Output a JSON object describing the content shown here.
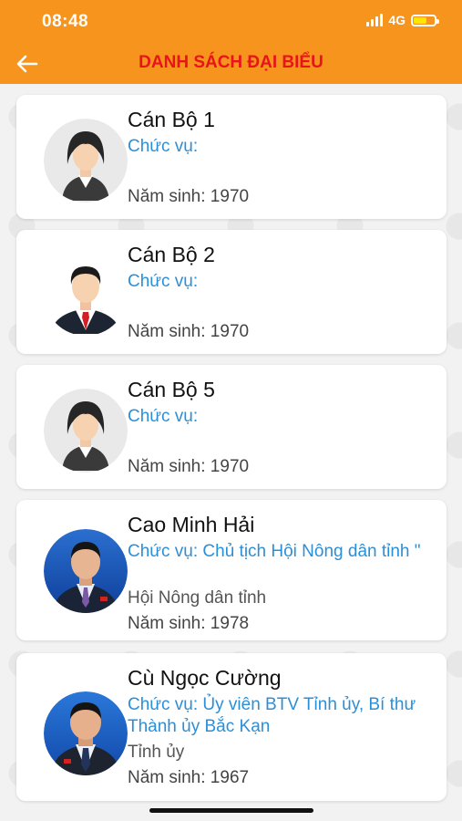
{
  "status_bar": {
    "time": "08:48",
    "network": "4G"
  },
  "header": {
    "title": "DANH SÁCH ĐẠI BIỂU",
    "back_icon": "arrow-left-icon",
    "background_color": "#f7941d",
    "title_color": "#e8141b"
  },
  "delegates": [
    {
      "name": "Cán Bộ 1",
      "role": "Chức vụ:",
      "organization": "",
      "birth": "Năm sinh: 1970",
      "avatar": "female-placeholder-avatar"
    },
    {
      "name": "Cán Bộ 2",
      "role": "Chức vụ:",
      "organization": "",
      "birth": "Năm sinh: 1970",
      "avatar": "male-placeholder-avatar"
    },
    {
      "name": "Cán Bộ 5",
      "role": "Chức vụ:",
      "organization": "",
      "birth": "Năm sinh: 1970",
      "avatar": "female-placeholder-avatar"
    },
    {
      "name": "Cao Minh Hải",
      "role": "Chức vụ: Chủ tịch Hội Nông dân tỉnh  \"",
      "organization": "Hội Nông dân tỉnh",
      "birth": "Năm sinh: 1978",
      "avatar": "portrait-photo"
    },
    {
      "name": "Cù Ngọc Cường",
      "role": "Chức vụ: Ủy viên BTV Tỉnh ủy, Bí thư Thành ủy Bắc Kạn",
      "organization": "Tỉnh ủy",
      "birth": "Năm sinh: 1967",
      "avatar": "portrait-photo"
    }
  ]
}
